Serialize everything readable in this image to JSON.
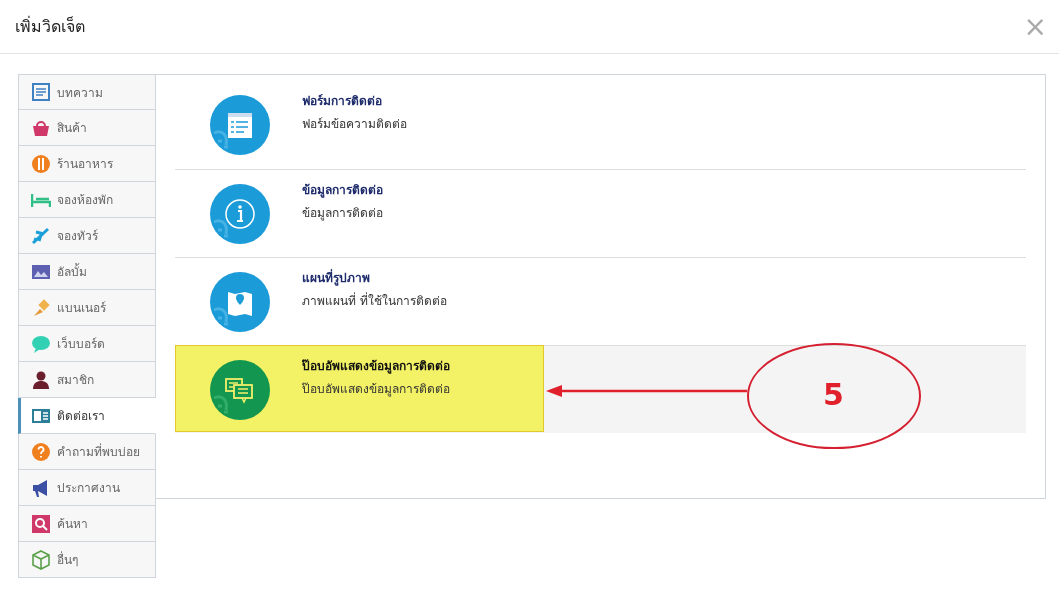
{
  "dialog": {
    "title": "เพิ่มวิดเจ็ต",
    "close": "×"
  },
  "sidebar": {
    "items": [
      {
        "label": "บทความ",
        "kind": "article",
        "selected": false
      },
      {
        "label": "สินค้า",
        "kind": "shop",
        "selected": false
      },
      {
        "label": "ร้านอาหาร",
        "kind": "restaurant",
        "selected": false
      },
      {
        "label": "จองห้องพัก",
        "kind": "hotel",
        "selected": false
      },
      {
        "label": "จองทัวร์",
        "kind": "tour",
        "selected": false
      },
      {
        "label": "อัลบั้ม",
        "kind": "album",
        "selected": false
      },
      {
        "label": "แบนเนอร์",
        "kind": "banner",
        "selected": false
      },
      {
        "label": "เว็บบอร์ด",
        "kind": "board",
        "selected": false
      },
      {
        "label": "สมาชิก",
        "kind": "member",
        "selected": false
      },
      {
        "label": "ติดต่อเรา",
        "kind": "contact",
        "selected": true
      },
      {
        "label": "คำถามที่พบบ่อย",
        "kind": "faq",
        "selected": false
      },
      {
        "label": "ประกาศงาน",
        "kind": "jobs",
        "selected": false
      },
      {
        "label": "ค้นหา",
        "kind": "search",
        "selected": false
      },
      {
        "label": "อื่นๆ",
        "kind": "other",
        "selected": false
      }
    ]
  },
  "widgets": [
    {
      "title": "ฟอร์มการติดต่อ",
      "description": "ฟอร์มข้อความติดต่อ",
      "kind": "form",
      "selected": false
    },
    {
      "title": "ข้อมูลการติดต่อ",
      "description": "ข้อมูลการติดต่อ",
      "kind": "info",
      "selected": false
    },
    {
      "title": "แผนที่รูปภาพ",
      "description": "ภาพแผนที่ ที่ใช้ในการติดต่อ",
      "kind": "map",
      "selected": false
    },
    {
      "title": "ป๊อบอัพแสดงข้อมูลการติดต่อ",
      "description": "ป๊อบอัพแสดงข้อมูลการติดต่อ",
      "kind": "popup",
      "selected": true
    }
  ],
  "annotation": {
    "label": "5"
  }
}
